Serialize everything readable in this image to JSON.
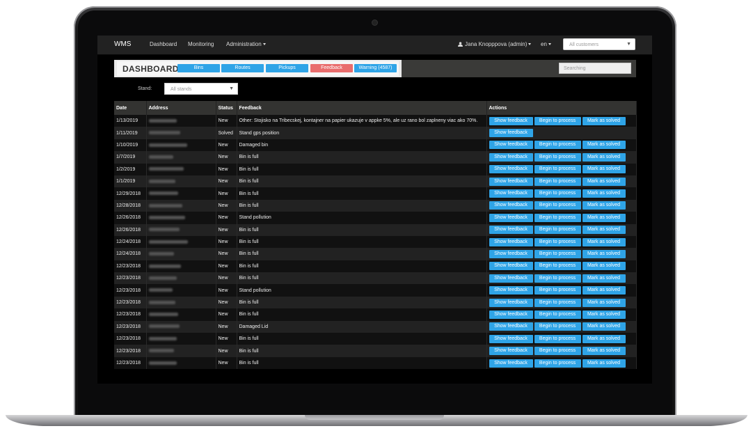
{
  "navbar": {
    "brand": "WMS",
    "links": [
      "Dashboard",
      "Monitoring",
      "Administration"
    ],
    "user": "Jana Knopppova (admin)",
    "language": "en",
    "customer_placeholder": "All customers"
  },
  "header": {
    "title": "DASHBOARD",
    "buttons": [
      {
        "label": "Bins",
        "color": "#2fa4e7"
      },
      {
        "label": "Routes",
        "color": "#2fa4e7"
      },
      {
        "label": "Pickups",
        "color": "#2fa4e7"
      },
      {
        "label": "Feedback",
        "color": "#e96d6d"
      },
      {
        "label": "Warning (4587)",
        "color": "#2fa4e7"
      }
    ],
    "search_placeholder": "Searching"
  },
  "filter": {
    "stand_label": "Stand:",
    "stand_value": "All stands"
  },
  "table": {
    "columns": [
      "Date",
      "Address",
      "Status",
      "Feedback",
      "Actions"
    ],
    "action_labels": {
      "show": "Show feedback",
      "process": "Begin to process",
      "solve": "Mark as solved"
    },
    "rows": [
      {
        "date": "1/13/2019",
        "status": "New",
        "feedback": "Other: Stojisko na Tribecskej, kontajner na papier ukazuje v appke 5%, ale uz rano bol zaplneny viac ako 70%.",
        "actions": [
          "show",
          "process",
          "solve"
        ]
      },
      {
        "date": "1/11/2019",
        "status": "Solved",
        "feedback": "Stand gps position",
        "actions": [
          "show"
        ]
      },
      {
        "date": "1/10/2019",
        "status": "New",
        "feedback": "Damaged bin",
        "actions": [
          "show",
          "process",
          "solve"
        ]
      },
      {
        "date": "1/7/2019",
        "status": "New",
        "feedback": "Bin is full",
        "actions": [
          "show",
          "process",
          "solve"
        ]
      },
      {
        "date": "1/2/2019",
        "status": "New",
        "feedback": "Bin is full",
        "actions": [
          "show",
          "process",
          "solve"
        ]
      },
      {
        "date": "1/1/2019",
        "status": "New",
        "feedback": "Bin is full",
        "actions": [
          "show",
          "process",
          "solve"
        ]
      },
      {
        "date": "12/29/2018",
        "status": "New",
        "feedback": "Bin is full",
        "actions": [
          "show",
          "process",
          "solve"
        ]
      },
      {
        "date": "12/28/2018",
        "status": "New",
        "feedback": "Bin is full",
        "actions": [
          "show",
          "process",
          "solve"
        ]
      },
      {
        "date": "12/26/2018",
        "status": "New",
        "feedback": "Stand pollution",
        "actions": [
          "show",
          "process",
          "solve"
        ]
      },
      {
        "date": "12/26/2018",
        "status": "New",
        "feedback": "Bin is full",
        "actions": [
          "show",
          "process",
          "solve"
        ]
      },
      {
        "date": "12/24/2018",
        "status": "New",
        "feedback": "Bin is full",
        "actions": [
          "show",
          "process",
          "solve"
        ]
      },
      {
        "date": "12/24/2018",
        "status": "New",
        "feedback": "Bin is full",
        "actions": [
          "show",
          "process",
          "solve"
        ]
      },
      {
        "date": "12/23/2018",
        "status": "New",
        "feedback": "Bin is full",
        "actions": [
          "show",
          "process",
          "solve"
        ]
      },
      {
        "date": "12/23/2018",
        "status": "New",
        "feedback": "Bin is full",
        "actions": [
          "show",
          "process",
          "solve"
        ]
      },
      {
        "date": "12/23/2018",
        "status": "New",
        "feedback": "Stand pollution",
        "actions": [
          "show",
          "process",
          "solve"
        ]
      },
      {
        "date": "12/23/2018",
        "status": "New",
        "feedback": "Bin is full",
        "actions": [
          "show",
          "process",
          "solve"
        ]
      },
      {
        "date": "12/23/2018",
        "status": "New",
        "feedback": "Bin is full",
        "actions": [
          "show",
          "process",
          "solve"
        ]
      },
      {
        "date": "12/23/2018",
        "status": "New",
        "feedback": "Damaged Lid",
        "actions": [
          "show",
          "process",
          "solve"
        ]
      },
      {
        "date": "12/23/2018",
        "status": "New",
        "feedback": "Bin is full",
        "actions": [
          "show",
          "process",
          "solve"
        ]
      },
      {
        "date": "12/23/2018",
        "status": "New",
        "feedback": "Bin is full",
        "actions": [
          "show",
          "process",
          "solve"
        ]
      },
      {
        "date": "12/23/2018",
        "status": "New",
        "feedback": "Bin is full",
        "actions": [
          "show",
          "process",
          "solve"
        ]
      }
    ]
  }
}
